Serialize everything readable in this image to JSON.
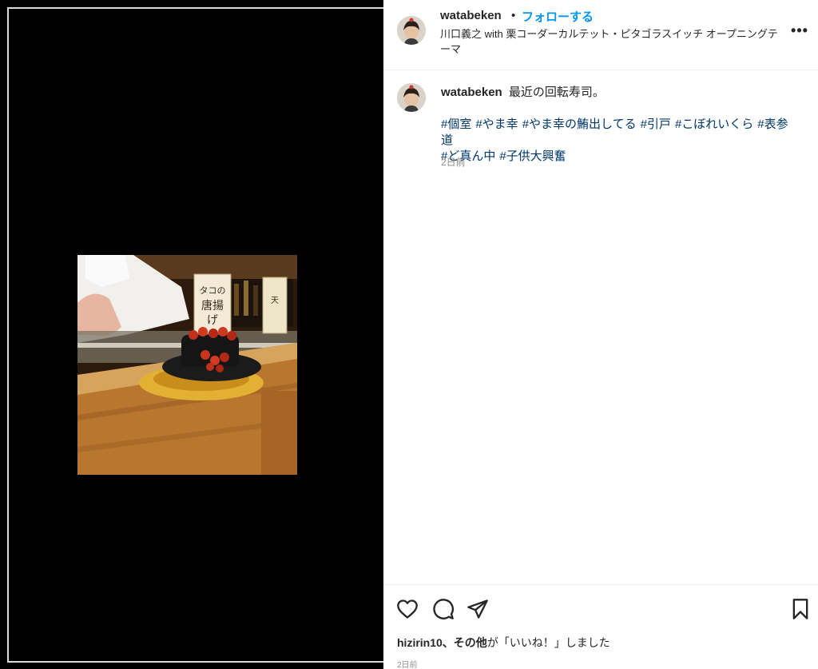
{
  "post": {
    "username": "watabeken",
    "follow_label": "フォローする",
    "separator": "•",
    "audio": "川口義之 with 栗コーダーカルテット・ピタゴラスイッチ オープニングテーマ",
    "more_label": "•••"
  },
  "caption": {
    "username": "watabeken",
    "text": "最近の回転寿司。",
    "hashtags": [
      "#個室",
      "#やま幸",
      "#やま幸の鮪出してる",
      "#引戸",
      "#こぼれいくら",
      "#表参道",
      "#ど真ん中",
      "#子供大興奮"
    ],
    "time": "2日前"
  },
  "likes": {
    "user": "hizirin10",
    "others": "、その他",
    "suffix": "が「いいね！」しました"
  },
  "footer_time": "2日前",
  "photo": {
    "sign_left": "タコの唐揚げ",
    "sign_right": "天ぷら"
  },
  "icons": {
    "like": "heart-icon",
    "comment": "comment-icon",
    "share": "share-icon",
    "save": "bookmark-icon",
    "more": "more-icon"
  },
  "colors": {
    "follow": "#0095f6",
    "hashtag": "#00376b",
    "muted": "#8e8e8e",
    "text": "#262626"
  }
}
